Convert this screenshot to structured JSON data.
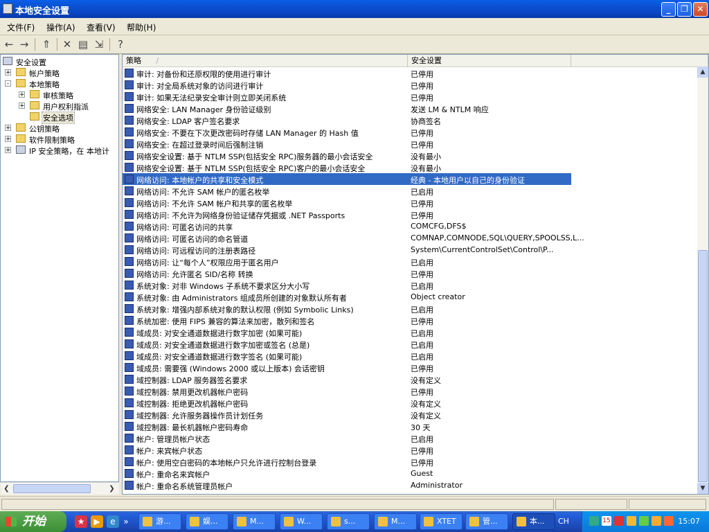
{
  "window": {
    "title": "本地安全设置",
    "controls": {
      "minimize": "_",
      "restore": "❐",
      "close": "✕"
    }
  },
  "menu": [
    {
      "label": "文件(F)"
    },
    {
      "label": "操作(A)"
    },
    {
      "label": "查看(V)"
    },
    {
      "label": "帮助(H)"
    }
  ],
  "toolbar": {
    "icons": [
      "back-icon",
      "forward-icon",
      "up-folder-icon",
      "delete-icon",
      "properties-icon",
      "export-list-icon",
      "help-icon"
    ]
  },
  "tree": {
    "root": "安全设置",
    "items": [
      {
        "label": "帐户策略",
        "expander": "+"
      },
      {
        "label": "本地策略",
        "expander": "-"
      },
      {
        "label": "审核策略",
        "expander": "+"
      },
      {
        "label": "用户权利指派",
        "expander": "+"
      },
      {
        "label": "安全选项",
        "expander": ""
      },
      {
        "label": "公钥策略",
        "expander": "+"
      },
      {
        "label": "软件限制策略",
        "expander": "+"
      },
      {
        "label": "IP 安全策略，在 本地计",
        "expander": "+"
      }
    ]
  },
  "list": {
    "columns": {
      "policy": "策略",
      "policy_sort": "/",
      "setting": "安全设置"
    },
    "rows": [
      {
        "policy": "审计: 对备份和还原权限的使用进行审计",
        "setting": "已停用"
      },
      {
        "policy": "审计: 对全局系统对象的访问进行审计",
        "setting": "已停用"
      },
      {
        "policy": "审计: 如果无法纪录安全审计则立即关闭系统",
        "setting": "已停用"
      },
      {
        "policy": "网络安全: LAN Manager 身份验证级别",
        "setting": "发送 LM & NTLM 响应"
      },
      {
        "policy": "网络安全: LDAP 客户签名要求",
        "setting": "协商签名"
      },
      {
        "policy": "网络安全: 不要在下次更改密码时存储 LAN Manager 的 Hash 值",
        "setting": "已停用"
      },
      {
        "policy": "网络安全: 在超过登录时间后强制注销",
        "setting": "已停用"
      },
      {
        "policy": "网络安全设置: 基于 NTLM SSP(包括安全 RPC)服务器的最小会话安全",
        "setting": "没有最小"
      },
      {
        "policy": "网络安全设置: 基于 NTLM SSP(包括安全 RPC)客户的最小会话安全",
        "setting": "没有最小"
      },
      {
        "policy": "网络访问: 本地帐户的共享和安全模式",
        "setting": "经典 - 本地用户以自己的身份验证",
        "selected": true
      },
      {
        "policy": "网络访问: 不允许 SAM 帐户的匿名枚举",
        "setting": "已启用"
      },
      {
        "policy": "网络访问: 不允许 SAM 帐户和共享的匿名枚举",
        "setting": "已停用"
      },
      {
        "policy": "网络访问: 不允许为网络身份验证储存凭据或 .NET Passports",
        "setting": "已停用"
      },
      {
        "policy": "网络访问: 可匿名访问的共享",
        "setting": "COMCFG,DFS$"
      },
      {
        "policy": "网络访问: 可匿名访问的命名管道",
        "setting": "COMNAP,COMNODE,SQL\\QUERY,SPOOLSS,L..."
      },
      {
        "policy": "网络访问: 可远程访问的注册表路径",
        "setting": "System\\CurrentControlSet\\Control\\P..."
      },
      {
        "policy": "网络访问: 让“每个人”权限应用于匿名用户",
        "setting": "已启用"
      },
      {
        "policy": "网络访问: 允许匿名 SID/名称 转换",
        "setting": "已停用"
      },
      {
        "policy": "系统对象: 对非 Windows 子系统不要求区分大小写",
        "setting": "已启用"
      },
      {
        "policy": "系统对象: 由 Administrators 组成员所创建的对象默认所有者",
        "setting": "Object creator"
      },
      {
        "policy": "系统对象: 增强内部系统对象的默认权限 (例如 Symbolic Links)",
        "setting": "已启用"
      },
      {
        "policy": "系统加密: 使用 FIPS 兼容的算法来加密，散列和签名",
        "setting": "已停用"
      },
      {
        "policy": "域成员: 对安全通道数据进行数字加密 (如果可能)",
        "setting": "已启用"
      },
      {
        "policy": "域成员: 对安全通道数据进行数字加密或签名 (总是)",
        "setting": "已启用"
      },
      {
        "policy": "域成员: 对安全通道数据进行数字签名 (如果可能)",
        "setting": "已启用"
      },
      {
        "policy": "域成员: 需要强 (Windows 2000 或以上版本) 会话密钥",
        "setting": "已停用"
      },
      {
        "policy": "域控制器: LDAP 服务器签名要求",
        "setting": "没有定义"
      },
      {
        "policy": "域控制器: 禁用更改机器帐户密码",
        "setting": "已停用"
      },
      {
        "policy": "域控制器: 拒绝更改机器帐户密码",
        "setting": "没有定义"
      },
      {
        "policy": "域控制器: 允许服务器操作员计划任务",
        "setting": "没有定义"
      },
      {
        "policy": "域控制器: 最长机器帐户密码寿命",
        "setting": "30 天"
      },
      {
        "policy": "帐户: 管理员帐户状态",
        "setting": "已启用"
      },
      {
        "policy": "帐户: 来宾帐户状态",
        "setting": "已停用"
      },
      {
        "policy": "帐户: 使用空白密码的本地帐户只允许进行控制台登录",
        "setting": "已停用"
      },
      {
        "policy": "帐户: 重命名来宾帐户",
        "setting": "Guest"
      },
      {
        "policy": "帐户: 重命名系统管理员帐户",
        "setting": "Administrator"
      }
    ]
  },
  "taskbar": {
    "start_label": "开始",
    "quicklaunch_more": "»",
    "tasks": [
      {
        "label": "游..."
      },
      {
        "label": "娱..."
      },
      {
        "label": "M..."
      },
      {
        "label": "W..."
      },
      {
        "label": "s..."
      },
      {
        "label": "M..."
      },
      {
        "label": "XTET"
      },
      {
        "label": "管..."
      },
      {
        "label": "本...",
        "active": true
      }
    ],
    "language": "CH",
    "tray_badge": "15",
    "clock": "15:07"
  },
  "colors": {
    "selection": "#316ac5",
    "titlebar": "#0a5fe6",
    "taskbar": "#245edb"
  }
}
